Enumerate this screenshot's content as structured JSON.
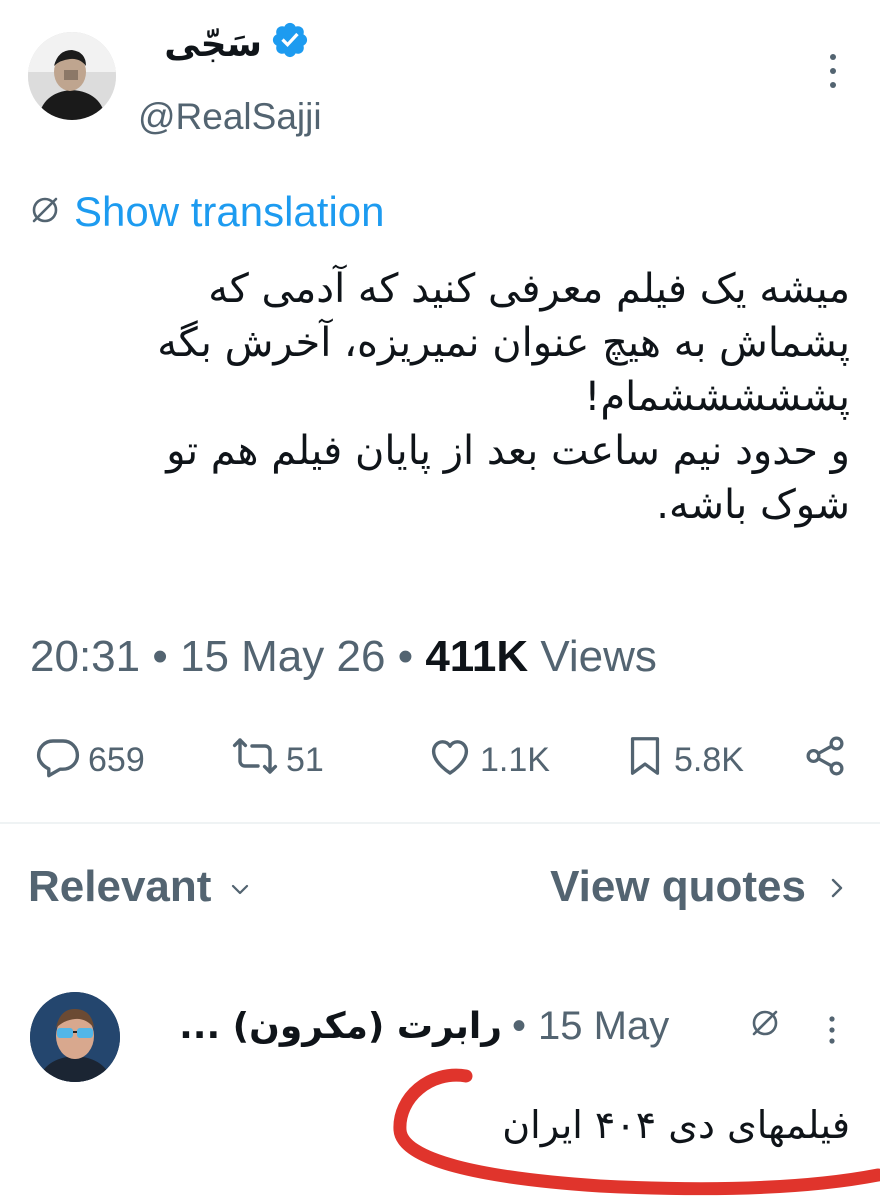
{
  "tweet": {
    "author": {
      "display_name": "سَجّی",
      "handle": "@RealSajji",
      "verified": true
    },
    "translate_label": "Show translation",
    "body_lines": [
      "میشه یک فیلم معرفی کنید که آدمی که",
      "پشماش به هیچ عنوان نمیریزه، آخرش بگه",
      "پشششششمام!",
      "و حدود نیم ساعت بعد از پایان فیلم هم تو",
      "شوک باشه."
    ],
    "time": "20:31",
    "date": "15 May 26",
    "separator": "•",
    "views_count": "411K",
    "views_label": "Views",
    "stats": {
      "replies": "659",
      "reposts": "51",
      "likes": "1.1K",
      "bookmarks": "5.8K"
    }
  },
  "replies_header": {
    "sort_label": "Relevant",
    "quotes_label": "View quotes"
  },
  "reply": {
    "display_name": "رابرت (مکرون) ...",
    "separator": "•",
    "date": "15 May",
    "text": "فیلمهای دی ۴۰۴ ایران"
  },
  "colors": {
    "accent_blue": "#1d9bf0",
    "secondary_text": "#536471",
    "primary_text": "#0f1419",
    "annotation_red": "#e0342c"
  }
}
